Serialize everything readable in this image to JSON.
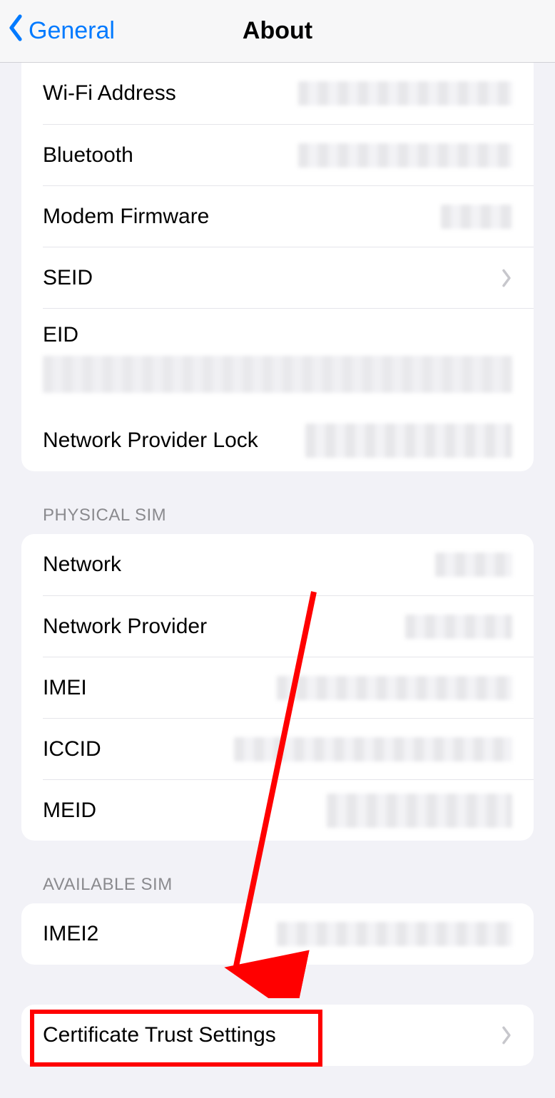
{
  "nav": {
    "back_label": "General",
    "title": "About"
  },
  "device_group": {
    "rows": {
      "wifi": "Wi-Fi Address",
      "bluetooth": "Bluetooth",
      "modem": "Modem Firmware",
      "seid": "SEID",
      "eid": "EID",
      "netlock": "Network Provider Lock"
    }
  },
  "physical_sim": {
    "header": "PHYSICAL SIM",
    "rows": {
      "network": "Network",
      "provider": "Network Provider",
      "imei": "IMEI",
      "iccid": "ICCID",
      "meid": "MEID"
    }
  },
  "available_sim": {
    "header": "AVAILABLE SIM",
    "rows": {
      "imei2": "IMEI2"
    }
  },
  "cert_group": {
    "cert": "Certificate Trust Settings"
  }
}
